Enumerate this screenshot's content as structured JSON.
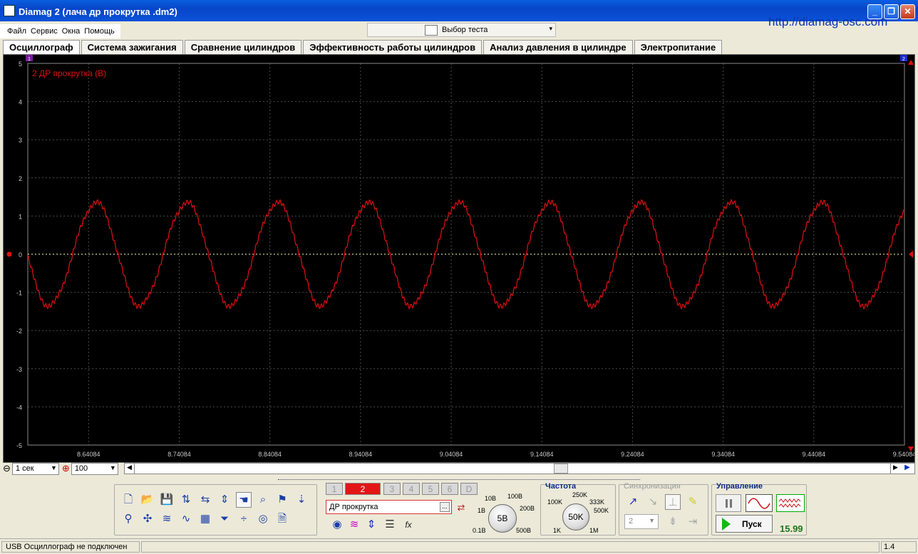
{
  "window": {
    "title": "Diamag 2 (лача др прокрутка .dm2)",
    "minimize_glyph": "_",
    "restore_glyph": "❐",
    "close_glyph": "✕"
  },
  "menu": {
    "items": [
      "Файл",
      "Сервис",
      "Окна",
      "Помощь"
    ]
  },
  "test_selector": {
    "label": "Выбор теста",
    "icon": "gear-document-icon",
    "arrow": "▾"
  },
  "brand_url": "http://diamag-osc.com",
  "tabs": [
    {
      "label": "Осциллограф",
      "active": true
    },
    {
      "label": "Система зажигания"
    },
    {
      "label": "Сравнение цилиндров"
    },
    {
      "label": "Эффективность работы цилиндров"
    },
    {
      "label": "Анализ давления в цилиндре"
    },
    {
      "label": "Электропитание"
    }
  ],
  "colors": {
    "trace": "#e01010",
    "grid": "#4a4a4a",
    "zero_line": "#ffffaa",
    "background": "#000000",
    "axis_text": "#c8c8c8"
  },
  "chart_data": {
    "type": "line",
    "channel_label": "2 ДР прокрутка (В)",
    "ylim": [
      -5,
      5
    ],
    "y_ticks": [
      "5",
      "4",
      "3",
      "2",
      "1",
      "0",
      "-1",
      "-2",
      "-3",
      "-4",
      "-5"
    ],
    "xlim": [
      8.5738,
      9.54084
    ],
    "x_ticks": [
      "8.64084",
      "8.74084",
      "8.84084",
      "8.94084",
      "9.04084",
      "9.14084",
      "9.24084",
      "9.34084",
      "9.44084",
      "9.54084"
    ],
    "x_tick_values": [
      8.64084,
      8.74084,
      8.84084,
      8.94084,
      9.04084,
      9.14084,
      9.24084,
      9.34084,
      9.44084,
      9.54084
    ],
    "series": [
      {
        "amplitude": 1.35,
        "period": 0.1,
        "first_peak": 8.6482,
        "samples": [
          [
            8.574,
            -0.9
          ],
          [
            8.579,
            -1.2
          ],
          [
            8.584,
            -1.33
          ],
          [
            8.592,
            -1.2
          ],
          [
            8.6,
            -0.6
          ],
          [
            8.608,
            0.05
          ],
          [
            8.616,
            0.5
          ],
          [
            8.625,
            0.9
          ],
          [
            8.635,
            1.15
          ],
          [
            8.648,
            1.35
          ],
          [
            8.66,
            1.15
          ],
          [
            8.672,
            0.45
          ],
          [
            8.684,
            -0.4
          ],
          [
            8.695,
            -1.05
          ],
          [
            8.704,
            -1.3
          ],
          [
            8.714,
            -1.2
          ],
          [
            8.728,
            -0.5
          ],
          [
            8.748,
            1.35
          ],
          [
            8.778,
            -1.3
          ],
          [
            8.848,
            1.35
          ],
          [
            8.878,
            -1.3
          ],
          [
            8.948,
            1.35
          ],
          [
            8.978,
            -1.3
          ],
          [
            9.048,
            1.35
          ],
          [
            9.078,
            -1.3
          ],
          [
            9.148,
            1.35
          ],
          [
            9.178,
            -1.3
          ],
          [
            9.248,
            1.35
          ],
          [
            9.278,
            -1.3
          ],
          [
            9.348,
            1.35
          ],
          [
            9.378,
            -1.3
          ],
          [
            9.448,
            1.35
          ],
          [
            9.478,
            -1.3
          ],
          [
            9.54,
            1.1
          ]
        ]
      }
    ],
    "grid": true,
    "marker_left": "1",
    "marker_right": "2"
  },
  "timebase": {
    "value": "1 сек",
    "zoom_value": "100"
  },
  "toolbar": {
    "row1": [
      {
        "name": "new-file-icon",
        "glyph": "🗋"
      },
      {
        "name": "open-folder-icon",
        "glyph": "📂"
      },
      {
        "name": "save-icon",
        "glyph": "💾"
      },
      {
        "name": "vertical-scale-icon",
        "glyph": "⇅"
      },
      {
        "name": "horizontal-scale-icon",
        "glyph": "⇆"
      },
      {
        "name": "auto-scale-icon",
        "glyph": "⇕"
      },
      {
        "name": "hand-pan-icon",
        "glyph": "☚"
      },
      {
        "name": "zoom-icon",
        "glyph": "⌕"
      },
      {
        "name": "add-marker-icon",
        "glyph": "⚑"
      },
      {
        "name": "zero-marker-icon",
        "glyph": "⇣"
      }
    ],
    "row2": [
      {
        "name": "filter-icon",
        "glyph": "⚲"
      },
      {
        "name": "cursor-cross-icon",
        "glyph": "✣"
      },
      {
        "name": "wave-overlay-icon",
        "glyph": "≋"
      },
      {
        "name": "wave-compare-icon",
        "glyph": "∿"
      },
      {
        "name": "table-icon",
        "glyph": "▦"
      },
      {
        "name": "funnel-icon",
        "glyph": "⏷"
      },
      {
        "name": "split-icon",
        "glyph": "÷"
      },
      {
        "name": "auto-timing-icon",
        "glyph": "◎"
      },
      {
        "name": "report-icon",
        "glyph": "🗎"
      }
    ]
  },
  "channels": {
    "buttons": [
      "1",
      "2",
      "3",
      "4",
      "5",
      "6",
      "D"
    ],
    "active": "2",
    "name": "ДР прокрутка",
    "dots": "...",
    "fx": "fx"
  },
  "volt_knob": {
    "value": "5В",
    "labels": [
      "10В",
      "100В",
      "1В",
      "200В",
      "0.1В",
      "500В"
    ]
  },
  "frequency": {
    "title": "Частота",
    "value": "50K",
    "labels": [
      "250K",
      "100K",
      "333K",
      "500K",
      "1K",
      "1M"
    ]
  },
  "sync": {
    "title": "Синхронизация",
    "channel_value": "2"
  },
  "control": {
    "title": "Управление",
    "start_label": "Пуск",
    "readout": "15.99"
  },
  "status": {
    "text": "USB Осциллограф не подключен",
    "version": "1.4"
  }
}
